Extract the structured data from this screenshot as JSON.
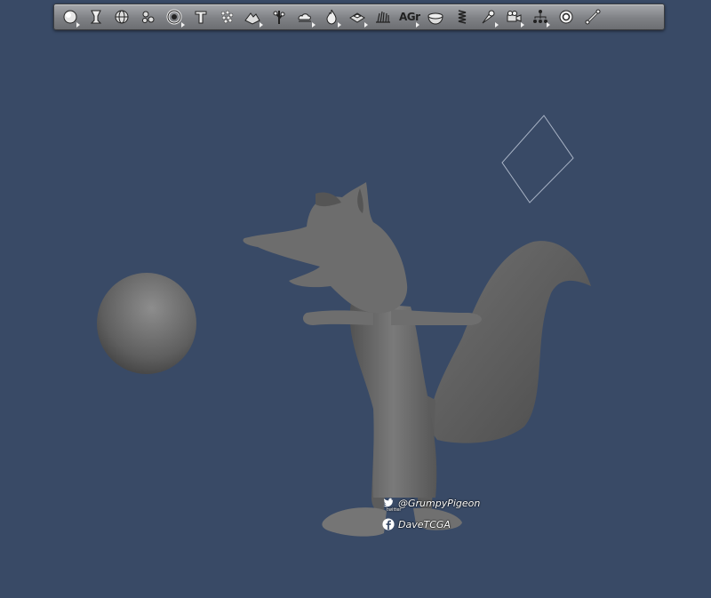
{
  "toolbar": {
    "tools": [
      {
        "name": "sphere-primitive-tool",
        "icon": "sphere-icon",
        "has_menu": true
      },
      {
        "name": "lathe-tool",
        "icon": "goblet-icon",
        "has_menu": false
      },
      {
        "name": "globe-tool",
        "icon": "globe-icon",
        "has_menu": false
      },
      {
        "name": "metaball-tool",
        "icon": "metaball-icon",
        "has_menu": false
      },
      {
        "name": "ring-tool",
        "icon": "ring-icon",
        "has_menu": true
      },
      {
        "name": "text-tool",
        "icon": "text-T-icon",
        "has_menu": false
      },
      {
        "name": "particles-tool",
        "icon": "particles-icon",
        "has_menu": false
      },
      {
        "name": "terrain-tool",
        "icon": "terrain-icon",
        "has_menu": true
      },
      {
        "name": "plant-tool",
        "icon": "plant-icon",
        "has_menu": false
      },
      {
        "name": "cloud-tool",
        "icon": "cloud-icon",
        "has_menu": true
      },
      {
        "name": "fire-tool",
        "icon": "flame-icon",
        "has_menu": true
      },
      {
        "name": "blocks-tool",
        "icon": "blocks-icon",
        "has_menu": true
      },
      {
        "name": "hair-tool",
        "icon": "hair-icon",
        "has_menu": false
      },
      {
        "name": "ag-tool",
        "icon": "agr-icon",
        "label": "AGr",
        "has_menu": true
      },
      {
        "name": "dish-tool",
        "icon": "dish-icon",
        "has_menu": false
      },
      {
        "name": "spring-tool",
        "icon": "spring-icon",
        "has_menu": false
      },
      {
        "name": "light-tool",
        "icon": "spotlight-icon",
        "has_menu": true
      },
      {
        "name": "camera-tool",
        "icon": "camera-icon",
        "has_menu": true
      },
      {
        "name": "null-tool",
        "icon": "hierarchy-icon",
        "has_menu": true
      },
      {
        "name": "target-tool",
        "icon": "target-icon",
        "has_menu": false
      },
      {
        "name": "bone-tool",
        "icon": "bone-icon",
        "has_menu": false
      }
    ]
  },
  "watermark": {
    "twitter_handle": "@GrumpyPigeon",
    "twitter_caption": "twitter",
    "facebook_name": "DaveTCGA"
  },
  "colors": {
    "background": "#394a66",
    "grid_line": "#5f6f8c",
    "model": "#6a6a6a"
  }
}
